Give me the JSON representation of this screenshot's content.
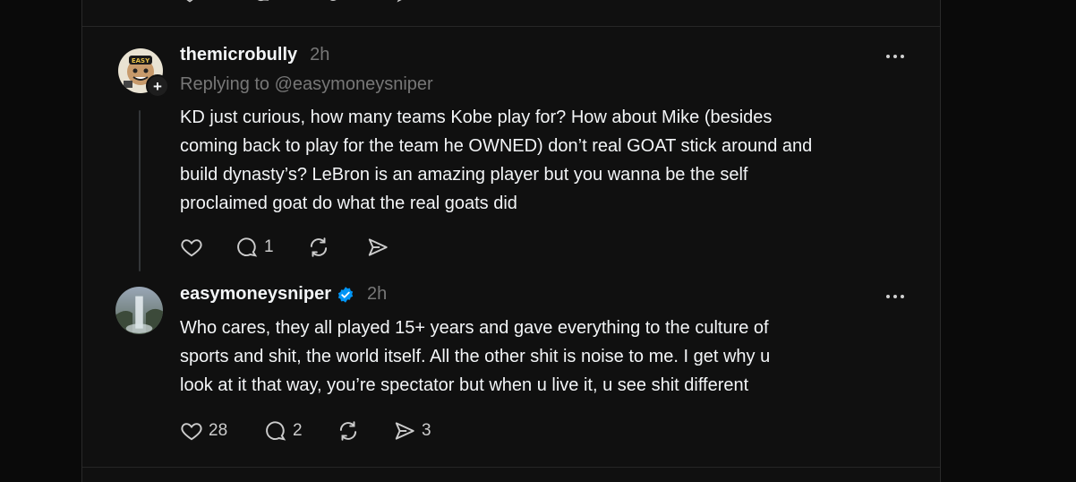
{
  "colors": {
    "background": "#101010",
    "text": "#f3f5f7",
    "muted": "#777777",
    "verified": "#0095f6"
  },
  "reply": {
    "username": "themicrobully",
    "time": "2h",
    "replying_to": "Replying to @easymoneysniper",
    "lines": [
      "KD just curious, how many teams Kobe play for? How about Mike (besides",
      "coming back to play for the team he OWNED) don’t real GOAT stick around and",
      "build dynasty’s? LeBron is an amazing player but you wanna be the self",
      "proclaimed goat do what the real goats did"
    ],
    "likes": "",
    "comments": "1",
    "reposts": "",
    "shares": "",
    "follow_icon": "plus-icon"
  },
  "response": {
    "username": "easymoneysniper",
    "verified": true,
    "time": "2h",
    "lines": [
      "Who cares, they all played 15+ years and gave everything to the culture of",
      "sports and shit, the world itself. All the other shit is noise to me. I get why u",
      "look at it that way, you’re spectator but when u live it, u see shit different"
    ],
    "likes": "28",
    "comments": "2",
    "reposts": "",
    "shares": "3"
  }
}
